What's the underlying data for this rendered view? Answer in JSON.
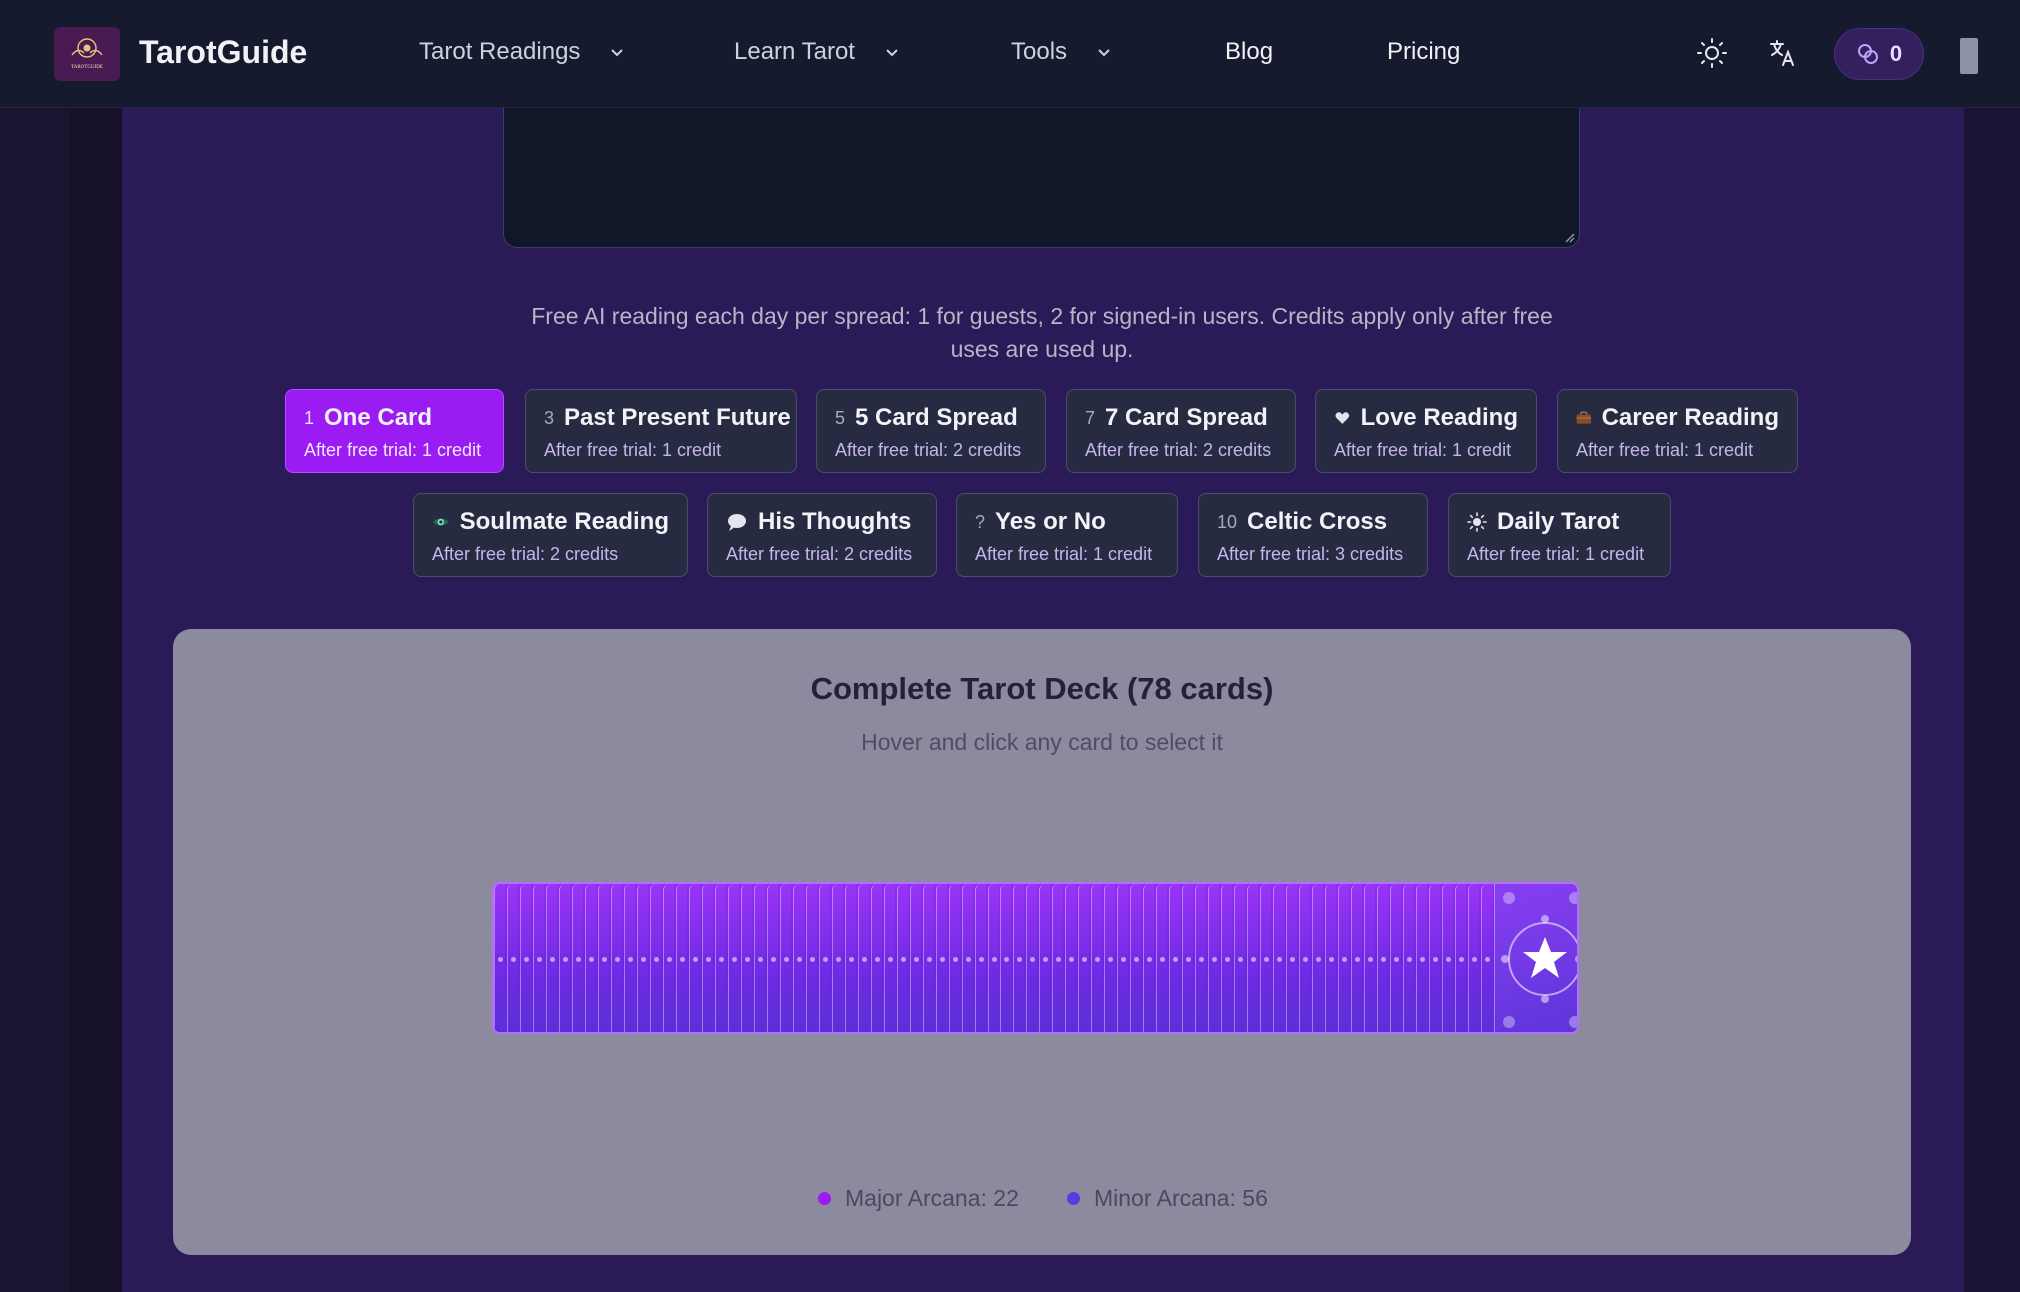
{
  "header": {
    "brand": "TarotGuide",
    "logo_text": "TAROTGUIDE",
    "nav": [
      {
        "label": "Tarot Readings",
        "has_dropdown": true
      },
      {
        "label": "Learn Tarot",
        "has_dropdown": true
      },
      {
        "label": "Tools",
        "has_dropdown": true
      },
      {
        "label": "Blog",
        "has_dropdown": false
      },
      {
        "label": "Pricing",
        "has_dropdown": false
      }
    ],
    "icons": [
      "sun-icon",
      "translate-icon"
    ],
    "credits": "0"
  },
  "question": {
    "value": "",
    "placeholder": ""
  },
  "notice": "Free AI reading each day per spread: 1 for guests, 2 for signed-in users. Credits apply only after free uses are used up.",
  "spreads": [
    {
      "num": "1",
      "icon": "",
      "label": "One Card",
      "sub": "After free trial: 1 credit",
      "active": true
    },
    {
      "num": "3",
      "icon": "",
      "label": "Past Present Future",
      "sub": "After free trial: 1 credit",
      "active": false
    },
    {
      "num": "5",
      "icon": "",
      "label": "5 Card Spread",
      "sub": "After free trial: 2 credits",
      "active": false
    },
    {
      "num": "7",
      "icon": "",
      "label": "7 Card Spread",
      "sub": "After free trial: 2 credits",
      "active": false
    },
    {
      "num": "",
      "icon": "heart-icon",
      "label": "Love Reading",
      "sub": "After free trial: 1 credit",
      "active": false
    },
    {
      "num": "",
      "icon": "briefcase-icon",
      "label": "Career Reading",
      "sub": "After free trial: 1 credit",
      "active": false
    },
    {
      "num": "",
      "icon": "eye-icon",
      "label": "Soulmate Reading",
      "sub": "After free trial: 2 credits",
      "active": false
    },
    {
      "num": "",
      "icon": "speech-bubble-icon",
      "label": "His Thoughts",
      "sub": "After free trial: 2 credits",
      "active": false
    },
    {
      "num": "?",
      "icon": "",
      "label": "Yes or No",
      "sub": "After free trial: 1 credit",
      "active": false
    },
    {
      "num": "10",
      "icon": "",
      "label": "Celtic Cross",
      "sub": "After free trial: 3 credits",
      "active": false
    },
    {
      "num": "",
      "icon": "sun-icon",
      "label": "Daily Tarot",
      "sub": "After free trial: 1 credit",
      "active": false
    }
  ],
  "deck": {
    "title": "Complete Tarot Deck (78 cards)",
    "subtitle": "Hover and click any card to select it",
    "card_count": 78,
    "legend": [
      {
        "label": "Major Arcana: 22",
        "color": "#9b1cf2"
      },
      {
        "label": "Minor Arcana: 56",
        "color": "#5d3ae0"
      }
    ]
  },
  "colors": {
    "accent": "#9b1cf2",
    "header_bg": "#151a2e",
    "panel_bg": "#8c8a9e"
  }
}
